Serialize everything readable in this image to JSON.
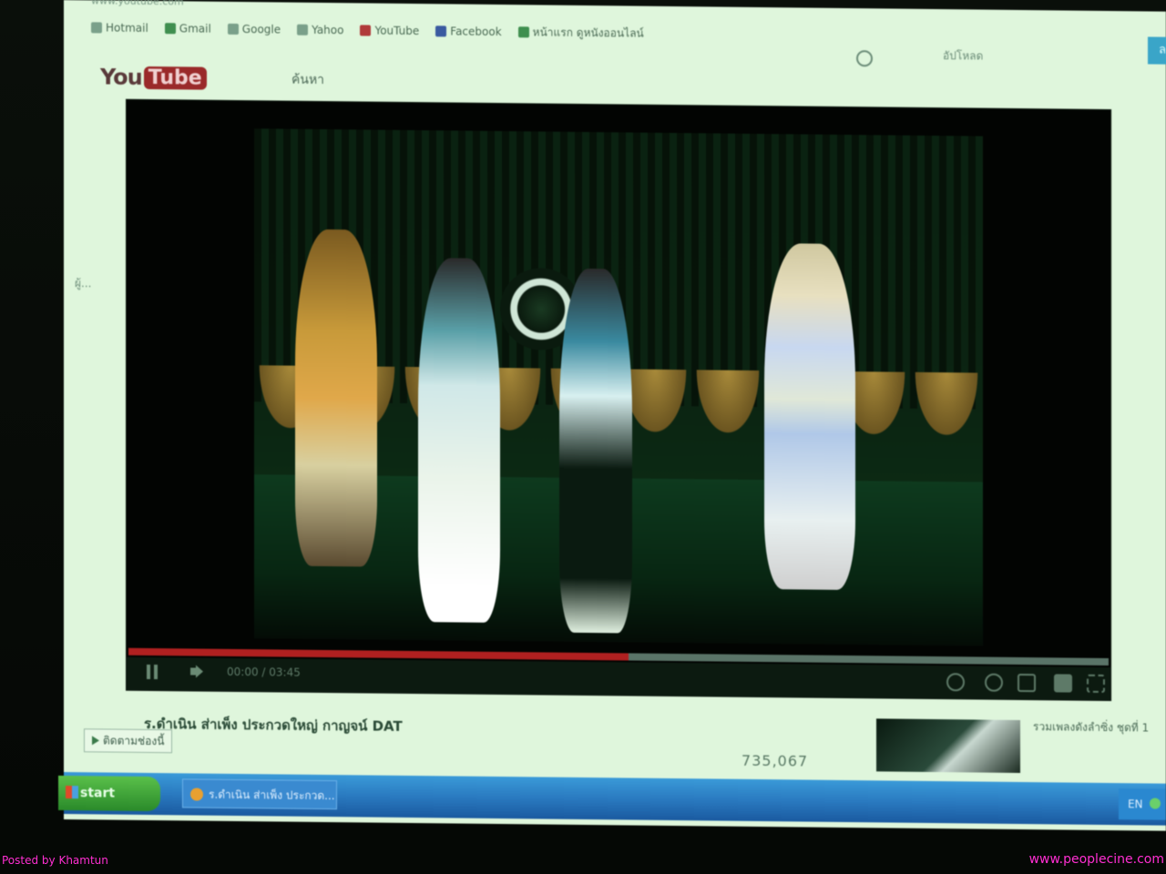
{
  "browser": {
    "address_partial": "www.youtube.com",
    "bookmarks": [
      {
        "label": "Hotmail",
        "icon": "bookmark-icon"
      },
      {
        "label": "Gmail",
        "icon": "bookmark-icon"
      },
      {
        "label": "Google",
        "icon": "bookmark-icon"
      },
      {
        "label": "Yahoo",
        "icon": "bookmark-icon"
      },
      {
        "label": "YouTube",
        "icon": "youtube-icon"
      },
      {
        "label": "Facebook",
        "icon": "facebook-icon"
      },
      {
        "label": "หน้าแรก ดูหนังออนไลน์",
        "icon": "page-icon"
      }
    ]
  },
  "youtube": {
    "logo_you": "You",
    "logo_tube": "Tube",
    "sub_label": "ค้นหา",
    "search_label": "อัปโหลด",
    "upload_label": "ลงชื่อเข้าใช้"
  },
  "player": {
    "time": "00:00 / 03:45",
    "progress_fraction": 0.51
  },
  "video": {
    "title": "ร.ดำเนิน ส่าเพ็ง ประกวดใหญ่ กาญจน์ DAT",
    "subscribe": "ติดตามช่องนี้",
    "views": "735,067"
  },
  "suggestion": {
    "text": "รวมเพลงดังลำซิ่ง ชุดที่ 1"
  },
  "taskbar": {
    "start_label": "start",
    "task_label": "ร.ดำเนิน ส่าเพ็ง ประกวด...",
    "tray_label": "EN"
  },
  "overlay": {
    "credit_left": "Posted by Khamtun",
    "credit_right": "www.peoplecine.com"
  },
  "colors": {
    "screen_bg": "#dff6dc",
    "progress_red": "#b02020",
    "taskbar_blue": "#2a7ac0",
    "credit_magenta": "#ff2fd2"
  }
}
